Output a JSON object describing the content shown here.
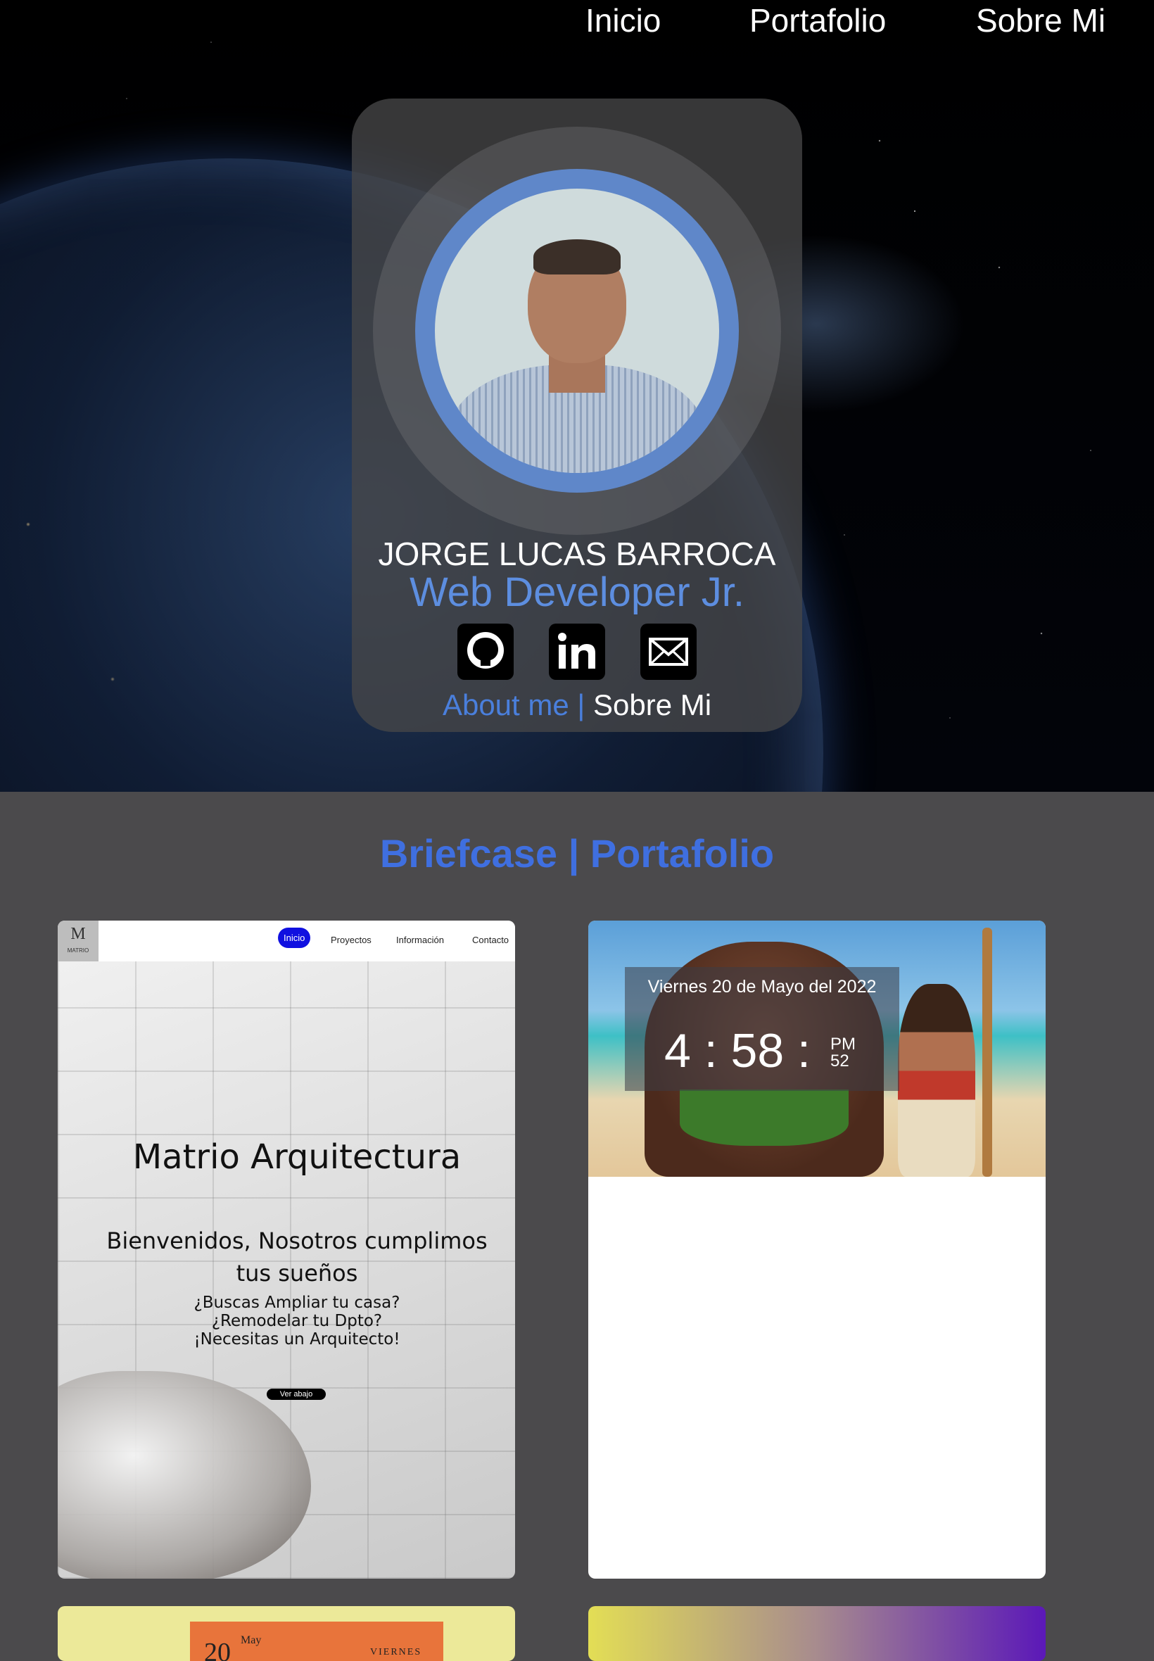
{
  "nav": {
    "items": [
      "Inicio",
      "Portafolio",
      "Sobre Mi"
    ]
  },
  "profile": {
    "name": "JORGE LUCAS BARROCA",
    "role": "Web Developer Jr.",
    "socials": [
      "github-icon",
      "linkedin-icon",
      "mail-icon"
    ],
    "about_en": "About me |",
    "about_es": "Sobre Mi"
  },
  "portfolio": {
    "title": "Briefcase | Portafolio",
    "project1": {
      "logo_letter": "M",
      "logo_text": "MATRIO",
      "nav": [
        "Inicio",
        "Proyectos",
        "Información",
        "Contacto"
      ],
      "title": "Matrio Arquitectura",
      "subtitle": "Bienvenidos, Nosotros cumplimos tus sueños",
      "questions": [
        "¿Buscas Ampliar tu casa?",
        "¿Remodelar tu Dpto?",
        "¡Necesitas un Arquitecto!"
      ],
      "button": "Ver abajo"
    },
    "project2": {
      "date": "Viernes 20 de Mayo del 2022",
      "time": "4 : 58 :",
      "ampm": "PM",
      "seconds": "52"
    },
    "project3": {
      "day_number": "20",
      "month": "May",
      "weekday": "VIERNES"
    }
  },
  "colors": {
    "accent": "#3f6fe0",
    "role": "#5d8ee0",
    "section_bg": "#4b4a4c"
  }
}
